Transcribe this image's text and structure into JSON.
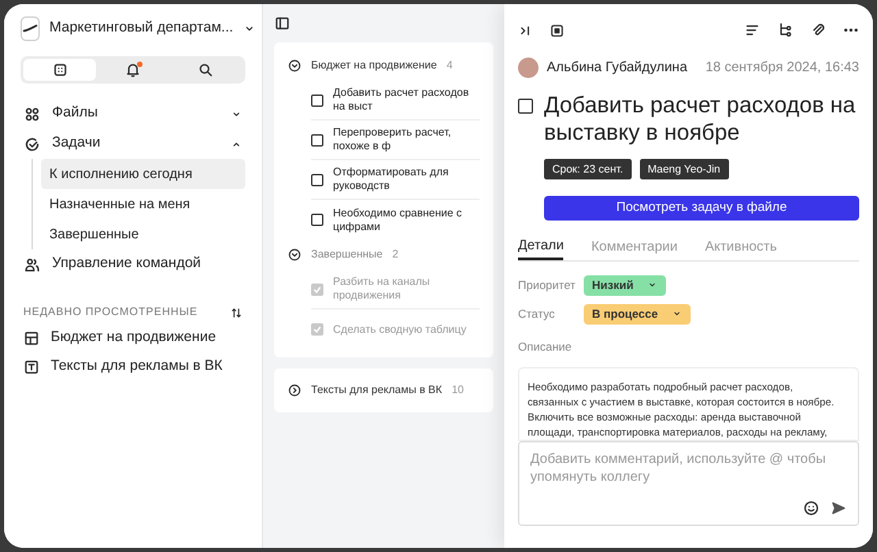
{
  "workspace": {
    "name": "Маркетинговый департам..."
  },
  "sidebar_tabs": [
    {
      "kind": "grid",
      "selected": true,
      "unread": false
    },
    {
      "kind": "bell",
      "selected": false,
      "unread": true
    },
    {
      "kind": "search",
      "selected": false,
      "unread": false
    }
  ],
  "nav": [
    {
      "label": "Файлы",
      "kind": "files",
      "expanded": false
    },
    {
      "label": "Задачи",
      "kind": "tasks",
      "expanded": true,
      "children": [
        {
          "label": "К исполнению сегодня",
          "selected": true
        },
        {
          "label": "Назначенные на меня",
          "selected": false
        },
        {
          "label": "Завершенные",
          "selected": false
        }
      ]
    },
    {
      "label": "Управление командой",
      "kind": "team"
    }
  ],
  "recent": {
    "heading": "НЕДАВНО ПРОСМОТРЕННЫЕ",
    "items": [
      {
        "label": "Бюджет на продвижение",
        "kind": "table"
      },
      {
        "label": "Тексты для рекламы в ВК",
        "kind": "text"
      }
    ]
  },
  "lists": [
    {
      "sections": [
        {
          "title": "Бюджет на продвижение",
          "count": "4",
          "expanded": true,
          "tasks": [
            {
              "title": "Добавить расчет расходов на выст",
              "checked": false
            },
            {
              "title": "Перепроверить расчет, похоже в ф",
              "checked": false
            },
            {
              "title": "Отформатировать для руководств",
              "checked": false
            },
            {
              "title": "Необходимо сравнение с цифрами",
              "checked": false
            }
          ]
        },
        {
          "title": "Завершенные",
          "count": "2",
          "expanded": true,
          "tasks": [
            {
              "title": "Разбить на каналы продвижения",
              "checked": true
            },
            {
              "title": "Сделать сводную таблицу",
              "checked": true
            }
          ]
        }
      ]
    },
    {
      "sections": [
        {
          "title": "Тексты для рекламы в ВК",
          "count": "10",
          "expanded": false
        }
      ]
    }
  ],
  "detail": {
    "author": "Альбина Губайдулина",
    "date": "18 сентября 2024, 16:43",
    "title": "Добавить расчет расходов на выставку в ноябре",
    "checked": false,
    "tags": [
      "Срок: 23 сент.",
      "Maeng Yeo-Jin"
    ],
    "button": "Посмотреть задачу в файле",
    "tabs": [
      {
        "label": "Детали",
        "selected": true
      },
      {
        "label": "Комментарии",
        "selected": false
      },
      {
        "label": "Активность",
        "selected": false
      }
    ],
    "fields": [
      {
        "label": "Приоритет",
        "value": "Низкий",
        "color": "#86e0a6"
      },
      {
        "label": "Статус",
        "value": "В процессе",
        "color": "#f9cd74"
      }
    ],
    "description_label": "Описание",
    "description_lines": [
      "Необходимо разработать подробный расчет расходов,",
      "связанных с участием в выставке, которая состоится в ноябре.",
      "Включить все возможные расходы: аренда выставочной",
      "площади, транспортировка материалов, расходы на рекламу,"
    ],
    "comment": {
      "placeholder": "Добавить комментарий, используйте @ чтобы упомянуть коллегу"
    }
  }
}
